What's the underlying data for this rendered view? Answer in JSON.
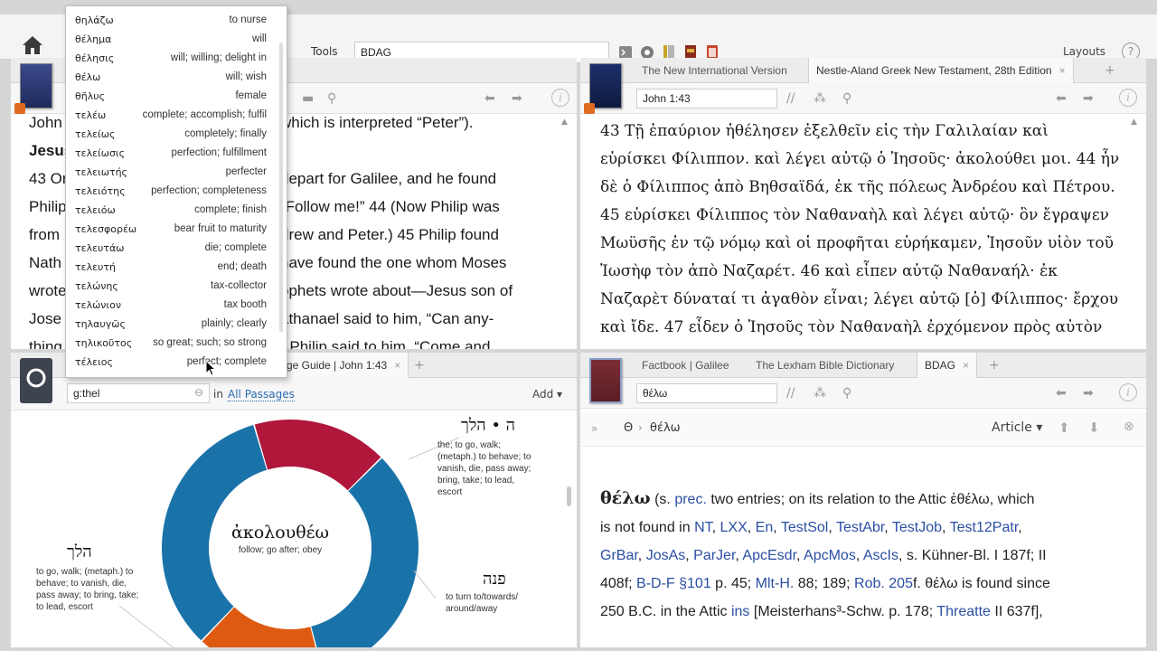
{
  "topbar": {
    "tools_label": "Tools",
    "search_value": "BDAG",
    "layouts_label": "Layouts",
    "help_label": "?"
  },
  "autocomplete": {
    "items": [
      {
        "word": "θηλάζω",
        "gloss": "to nurse"
      },
      {
        "word": "θέλημα",
        "gloss": "will"
      },
      {
        "word": "θέλησις",
        "gloss": "will; willing; delight in"
      },
      {
        "word": "θέλω",
        "gloss": "will; wish"
      },
      {
        "word": "θῆλυς",
        "gloss": "female"
      },
      {
        "word": "τελέω",
        "gloss": "complete; accomplish; fulfil"
      },
      {
        "word": "τελείως",
        "gloss": "completely; finally"
      },
      {
        "word": "τελείωσις",
        "gloss": "perfection; fulfillment"
      },
      {
        "word": "τελειωτής",
        "gloss": "perfecter"
      },
      {
        "word": "τελειότης",
        "gloss": "perfection; completeness"
      },
      {
        "word": "τελειόω",
        "gloss": "complete; finish"
      },
      {
        "word": "τελεσφορέω",
        "gloss": "bear fruit to maturity"
      },
      {
        "word": "τελευτάω",
        "gloss": "die; complete"
      },
      {
        "word": "τελευτή",
        "gloss": "end; death"
      },
      {
        "word": "τελώνης",
        "gloss": "tax-collector"
      },
      {
        "word": "τελώνιον",
        "gloss": "tax booth"
      },
      {
        "word": "τηλαυγῶς",
        "gloss": "plainly; clearly"
      },
      {
        "word": "τηλικοῦτος",
        "gloss": "so great; such; so strong"
      },
      {
        "word": "τέλειος",
        "gloss": "perfect; complete"
      }
    ]
  },
  "top_left": {
    "lines": [
      {
        "pre": "John",
        "post": "which is interpreted “Peter”)."
      },
      {
        "pre": "Jesus",
        "post": ""
      },
      {
        "pre": "43 Or",
        "post": "depart for Galilee, and he found"
      },
      {
        "pre": "Philip",
        "post": "“Follow me!” 44 (Now Philip was"
      },
      {
        "pre": "from",
        "post": "drew and Peter.) 45 Philip found"
      },
      {
        "pre": "Nath",
        "post": "have found the one whom Moses"
      },
      {
        "pre": "wrote",
        "post": "ophets wrote about—Jesus son of"
      },
      {
        "pre": "Jose",
        "post": "athanael said to him, “Can any-"
      },
      {
        "pre": "thing",
        "post": "” Philip said to him, “Come and"
      }
    ]
  },
  "top_right": {
    "tabs": [
      "The New International Version",
      "Nestle-Aland Greek New Testament, 28th Edition"
    ],
    "reference": "John 1:43",
    "lines": [
      "43 Τῇ ἐπαύριον ἠθέλησεν ἐξελθεῖν εἰς τὴν Γαλιλαίαν καὶ",
      "εὑρίσκει Φίλιππον. καὶ λέγει αὐτῷ ὁ Ἰησοῦς· ἀκολούθει μοι. 44 ἦν",
      "δὲ ὁ Φίλιππος ἀπὸ Βηθσαϊδά, ἐκ τῆς πόλεως Ἀνδρέου καὶ Πέτρου.",
      "45 εὑρίσκει Φίλιππος τὸν Ναθαναὴλ καὶ λέγει αὐτῷ· ὃν ἔγραψεν",
      "Μωϋσῆς ἐν τῷ νόμῳ καὶ οἱ προφῆται εὑρήκαμεν, Ἰησοῦν υἱὸν τοῦ",
      "Ἰωσὴφ τὸν ἀπὸ Ναζαρέτ. 46 καὶ εἶπεν αὐτῷ Ναθαναήλ· ἐκ",
      "Ναζαρὲτ δύναταί τι ἀγαθὸν εἶναι; λέγει αὐτῷ [ὁ] Φίλιππος· ἔρχου",
      "καὶ ἴδε. 47 εἶδεν ὁ Ἰησοῦς τὸν Ναθαναὴλ ἐρχόμενον πρὸς αὐτὸν"
    ]
  },
  "bottom_left": {
    "tab_label": "ge Guide | John 1:43",
    "query": "g:thel",
    "in_label": "in",
    "scope": "All Passages",
    "add_label": "Add",
    "center_word": "ἀκολουθέω",
    "center_gloss": "follow; go after; obey",
    "segments": [
      {
        "label": "ה • הלך",
        "gloss": [
          "the; to go, walk;",
          "(metaph.) to behave; to",
          "vanish, die, pass away;",
          "bring, take; to lead,",
          "escort"
        ],
        "color": "#b0173a",
        "share": 0.18
      },
      {
        "label": "הלך",
        "gloss": [
          "to go, walk; (metaph.) to",
          "behave; to vanish, die,",
          "pass away; to bring, take;",
          "to lead, escort"
        ],
        "color": "#1a73a8",
        "share": 0.35
      },
      {
        "label": "פנה",
        "gloss": [
          "to turn to/towards/",
          "around/away"
        ],
        "color": "#de5a12",
        "share": 0.17
      }
    ]
  },
  "bottom_right": {
    "tabs": [
      "Factbook | Galilee",
      "The Lexham Bible Dictionary",
      "BDAG"
    ],
    "search": "θέλω",
    "breadcrumb": [
      "Θ",
      "θέλω"
    ],
    "article_label": "Article",
    "lines": [
      [
        {
          "t": "θέλω",
          "b": true
        },
        {
          "t": " (s. "
        },
        {
          "t": "prec.",
          "l": true
        },
        {
          "t": " two entries; on its relation to the Attic ἐθέλω, which"
        }
      ],
      [
        {
          "t": "is not found in "
        },
        {
          "t": "NT",
          "l": true
        },
        {
          "t": ", "
        },
        {
          "t": "LXX",
          "l": true
        },
        {
          "t": ", "
        },
        {
          "t": "En",
          "l": true
        },
        {
          "t": ", "
        },
        {
          "t": "TestSol",
          "l": true
        },
        {
          "t": ", "
        },
        {
          "t": "TestAbr",
          "l": true
        },
        {
          "t": ", "
        },
        {
          "t": "TestJob",
          "l": true
        },
        {
          "t": ", "
        },
        {
          "t": "Test12Patr",
          "l": true
        },
        {
          "t": ","
        }
      ],
      [
        {
          "t": "GrBar",
          "l": true
        },
        {
          "t": ", "
        },
        {
          "t": "JosAs",
          "l": true
        },
        {
          "t": ", "
        },
        {
          "t": "ParJer",
          "l": true
        },
        {
          "t": ", "
        },
        {
          "t": "ApcEsdr",
          "l": true
        },
        {
          "t": ", "
        },
        {
          "t": "ApcMos",
          "l": true
        },
        {
          "t": ", "
        },
        {
          "t": "AscIs",
          "l": true
        },
        {
          "t": ", s. Kühner-Bl. I 187f; II"
        }
      ],
      [
        {
          "t": "408f; "
        },
        {
          "t": "B-D-F §101",
          "l": true
        },
        {
          "t": " p. 45; "
        },
        {
          "t": "Mlt-H.",
          "l": true
        },
        {
          "t": " 88; 189; "
        },
        {
          "t": "Rob. 205",
          "l": true
        },
        {
          "t": "f. θέλω is found since"
        }
      ],
      [
        {
          "t": "250 B.C. in the Attic "
        },
        {
          "t": "ins",
          "l": true
        },
        {
          "t": " [Meisterhans³-Schw. p. 178; "
        },
        {
          "t": "Threatte",
          "l": true
        },
        {
          "t": " II 637f],"
        }
      ]
    ]
  }
}
